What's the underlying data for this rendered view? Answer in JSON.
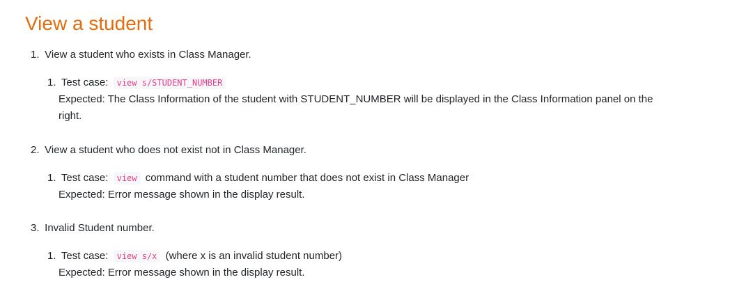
{
  "title": "View a student",
  "items": [
    {
      "number": "1.",
      "text": "View a student who exists in Class Manager.",
      "sub": {
        "number": "1.",
        "prefix": "Test case:",
        "code": "view s/STUDENT_NUMBER",
        "suffix": "",
        "expected": "Expected: The Class Information of the student with STUDENT_NUMBER will be displayed in the Class Information panel on the",
        "expected_cont": "right."
      }
    },
    {
      "number": "2.",
      "text": "View a student who does not exist not in Class Manager.",
      "sub": {
        "number": "1.",
        "prefix": "Test case:",
        "code": "view",
        "suffix": "command with a student number that does not exist in Class Manager",
        "expected": "Expected: Error message shown in the display result."
      }
    },
    {
      "number": "3.",
      "text": "Invalid Student number.",
      "sub": {
        "number": "1.",
        "prefix": "Test case:",
        "code": "view s/x",
        "suffix": "(where x is an invalid student number)",
        "expected": "Expected: Error message shown in the display result."
      }
    }
  ]
}
